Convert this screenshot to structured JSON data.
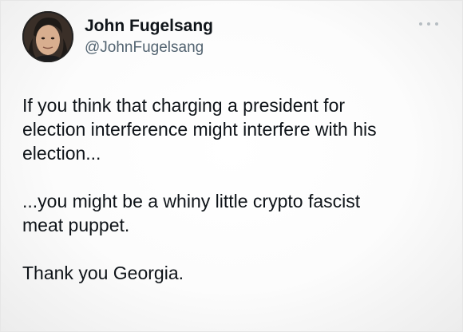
{
  "tweet": {
    "author_name": "John Fugelsang",
    "author_handle": "@JohnFugelsang",
    "more_icon": "more-horizontal-icon",
    "paragraphs": [
      "If you think that charging a president for\nelection interference might interfere with his\nelection...",
      "...you might be a whiny little crypto fascist\nmeat puppet.",
      "Thank you Georgia."
    ]
  },
  "colors": {
    "name": "#0f1419",
    "handle": "#536471",
    "text": "#0f1419",
    "avatar_ring": "#2b2a28"
  }
}
